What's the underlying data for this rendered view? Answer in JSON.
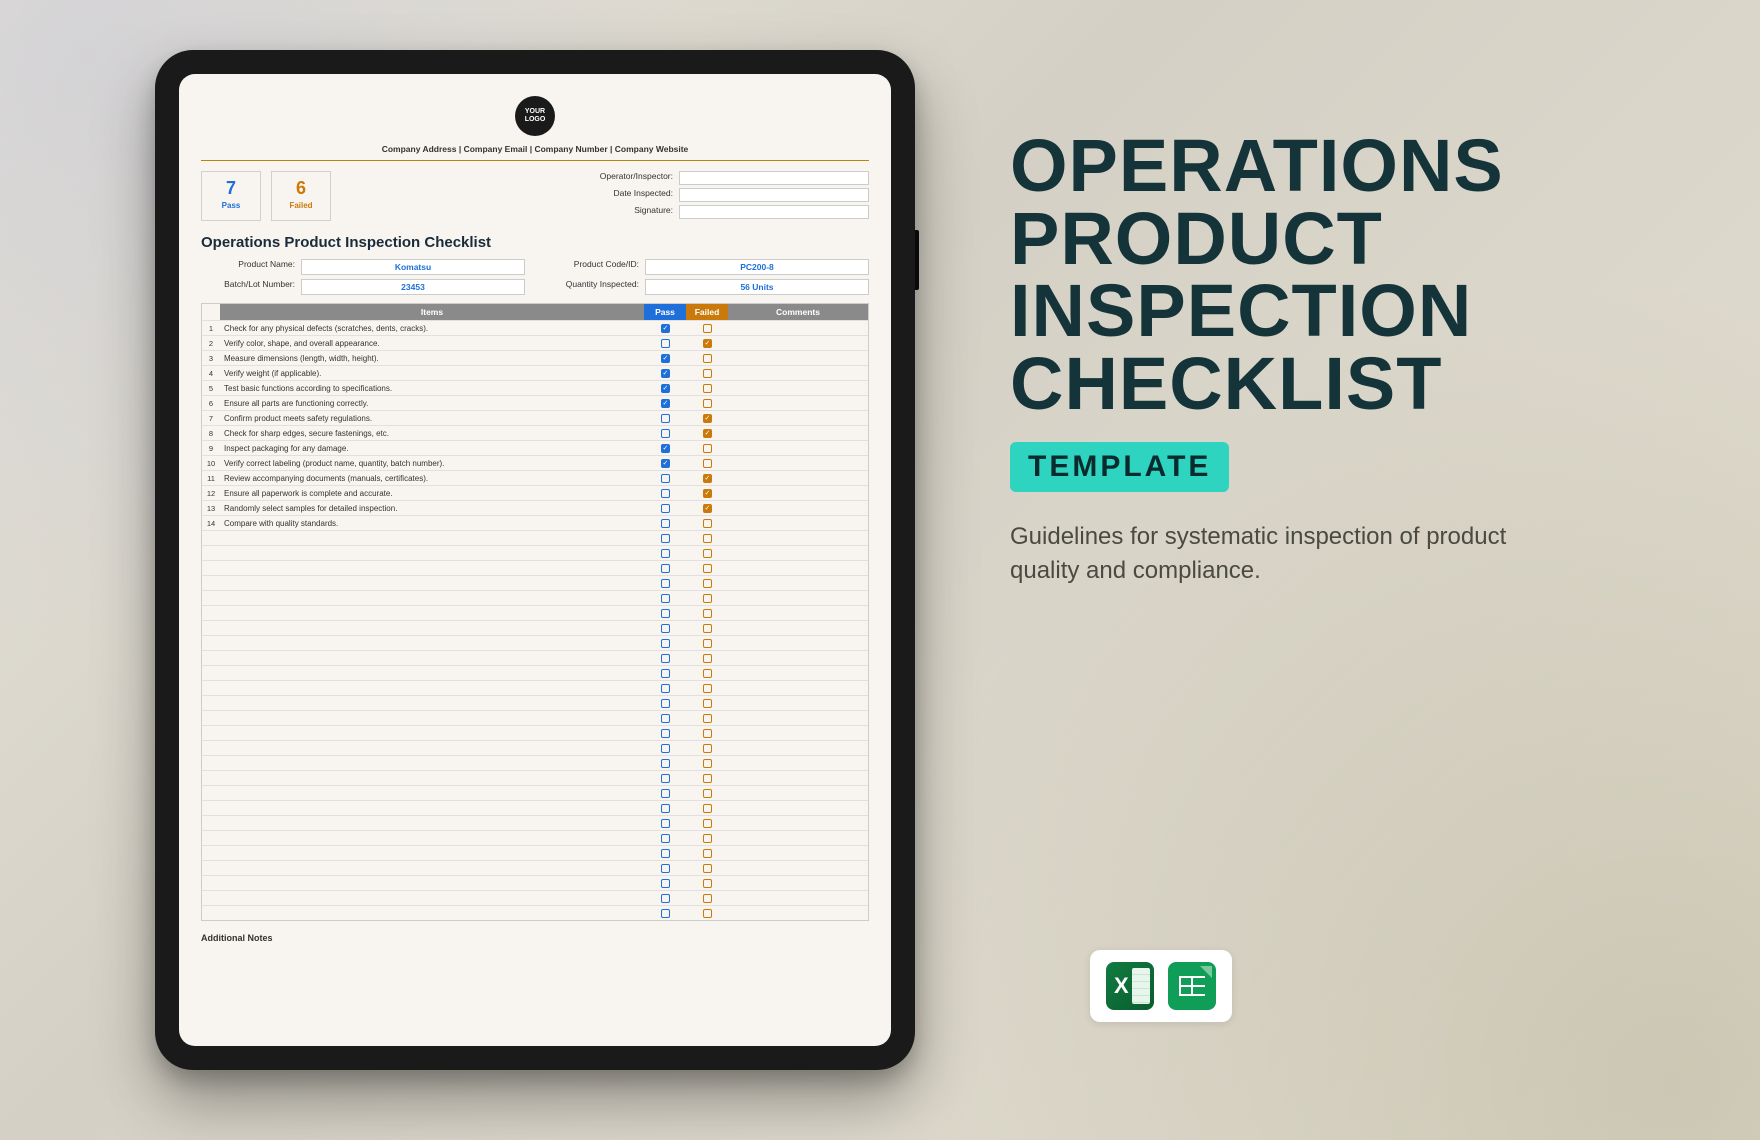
{
  "logo_text": "YOUR LOGO",
  "company_line": "Company Address | Company Email | Company Number | Company Website",
  "counts": {
    "pass": {
      "num": "7",
      "label": "Pass"
    },
    "fail": {
      "num": "6",
      "label": "Failed"
    }
  },
  "meta": {
    "operator_label": "Operator/Inspector:",
    "date_label": "Date Inspected:",
    "signature_label": "Signature:"
  },
  "doc_title": "Operations Product Inspection Checklist",
  "product": {
    "name_label": "Product Name:",
    "name_value": "Komatsu",
    "batch_label": "Batch/Lot Number:",
    "batch_value": "23453",
    "code_label": "Product Code/ID:",
    "code_value": "PC200-8",
    "qty_label": "Quantity Inspected:",
    "qty_value": "56 Units"
  },
  "headers": {
    "items": "Items",
    "pass": "Pass",
    "failed": "Failed",
    "comments": "Comments"
  },
  "rows": [
    {
      "n": "1",
      "item": "Check for any physical defects (scratches, dents, cracks).",
      "pass": true,
      "fail": false
    },
    {
      "n": "2",
      "item": "Verify color, shape, and overall appearance.",
      "pass": false,
      "fail": true
    },
    {
      "n": "3",
      "item": "Measure dimensions (length, width, height).",
      "pass": true,
      "fail": false
    },
    {
      "n": "4",
      "item": "Verify weight (if applicable).",
      "pass": true,
      "fail": false
    },
    {
      "n": "5",
      "item": "Test basic functions according to specifications.",
      "pass": true,
      "fail": false
    },
    {
      "n": "6",
      "item": "Ensure all parts are functioning correctly.",
      "pass": true,
      "fail": false
    },
    {
      "n": "7",
      "item": "Confirm product meets safety regulations.",
      "pass": false,
      "fail": true
    },
    {
      "n": "8",
      "item": "Check for sharp edges, secure fastenings, etc.",
      "pass": false,
      "fail": true
    },
    {
      "n": "9",
      "item": "Inspect packaging for any damage.",
      "pass": true,
      "fail": false
    },
    {
      "n": "10",
      "item": "Verify correct labeling (product name, quantity, batch number).",
      "pass": true,
      "fail": false
    },
    {
      "n": "11",
      "item": "Review accompanying documents (manuals, certificates).",
      "pass": false,
      "fail": true
    },
    {
      "n": "12",
      "item": "Ensure all paperwork is complete and accurate.",
      "pass": false,
      "fail": true
    },
    {
      "n": "13",
      "item": "Randomly select samples for detailed inspection.",
      "pass": false,
      "fail": true
    },
    {
      "n": "14",
      "item": "Compare with quality standards.",
      "pass": false,
      "fail": false
    }
  ],
  "empty_rows": 26,
  "notes_title": "Additional Notes",
  "promo": {
    "title": "OPERATIONS PRODUCT INSPECTION CHECKLIST",
    "badge": "TEMPLATE",
    "description": "Guidelines for systematic inspection of product quality and compliance."
  },
  "apps": {
    "excel": "Excel",
    "sheets": "Google Sheets"
  }
}
